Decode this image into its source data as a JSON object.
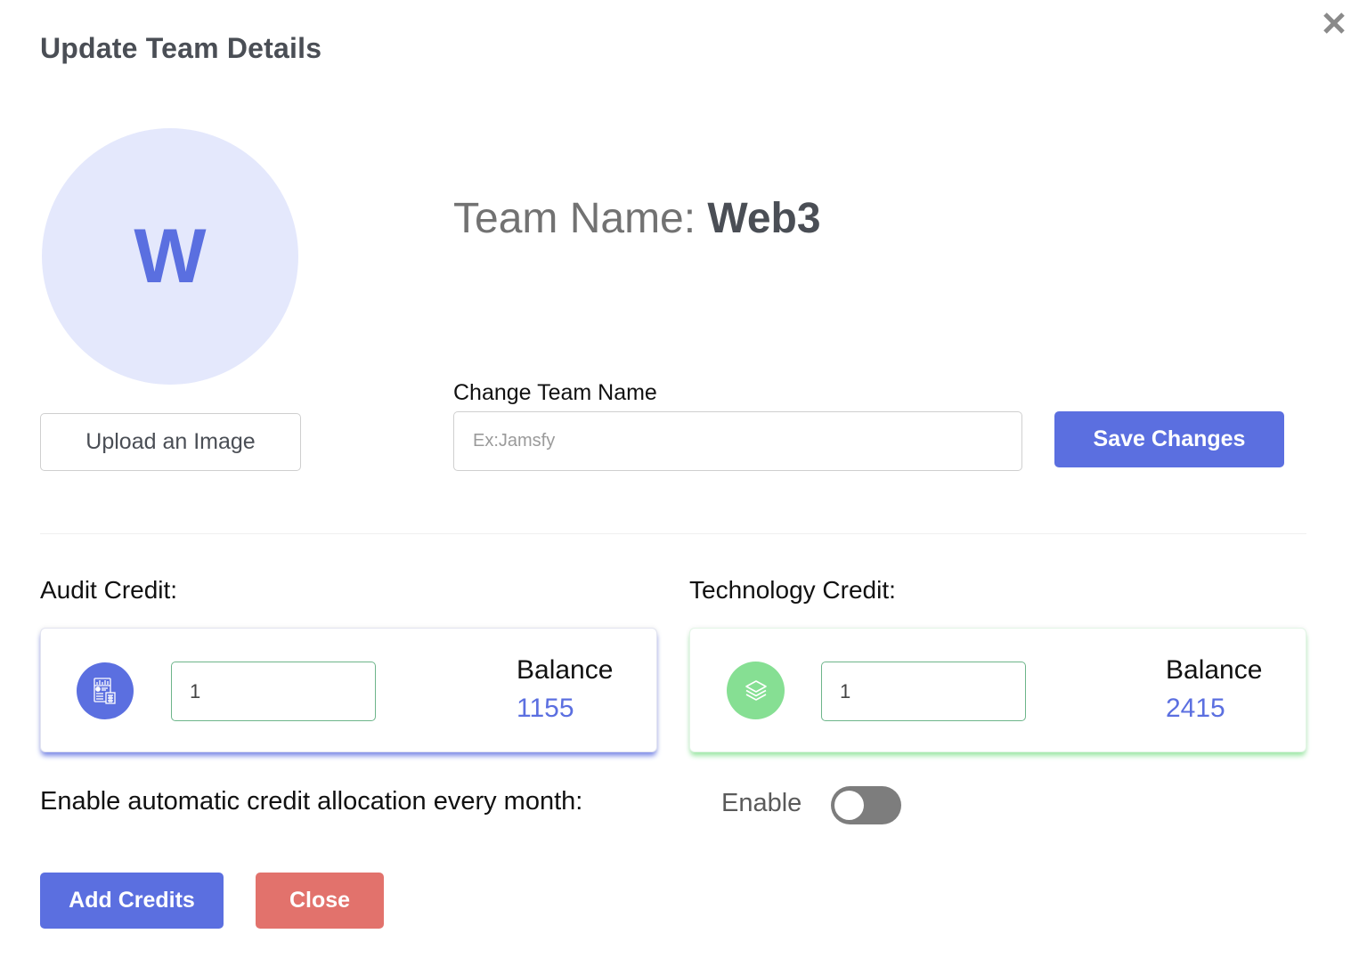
{
  "dialog": {
    "title": "Update Team Details",
    "close_icon": "close-icon"
  },
  "avatar": {
    "initial": "W",
    "bg_color": "#e4e8fc",
    "text_color": "#5a6fe0"
  },
  "team": {
    "name_label": "Team Name: ",
    "name_value": "Web3"
  },
  "upload": {
    "label": "Upload an Image"
  },
  "change_name": {
    "label": "Change Team Name",
    "placeholder": "Ex:Jamsfy",
    "value": "",
    "save_label": "Save Changes"
  },
  "credits": {
    "audit": {
      "label": "Audit Credit:",
      "icon": "report-calculator-icon",
      "input_value": "1",
      "balance_label": "Balance",
      "balance_value": "1155",
      "accent": "#5b6fe0"
    },
    "technology": {
      "label": "Technology Credit:",
      "icon": "layers-icon",
      "input_value": "1",
      "balance_label": "Balance",
      "balance_value": "2415",
      "accent": "#86df93"
    }
  },
  "auto_allocation": {
    "label": "Enable automatic credit allocation every month:",
    "toggle_label": "Enable",
    "enabled": false
  },
  "actions": {
    "add_credits_label": "Add Credits",
    "close_label": "Close"
  },
  "colors": {
    "primary": "#5b6fe0",
    "danger": "#e2726c",
    "success": "#86df93"
  }
}
